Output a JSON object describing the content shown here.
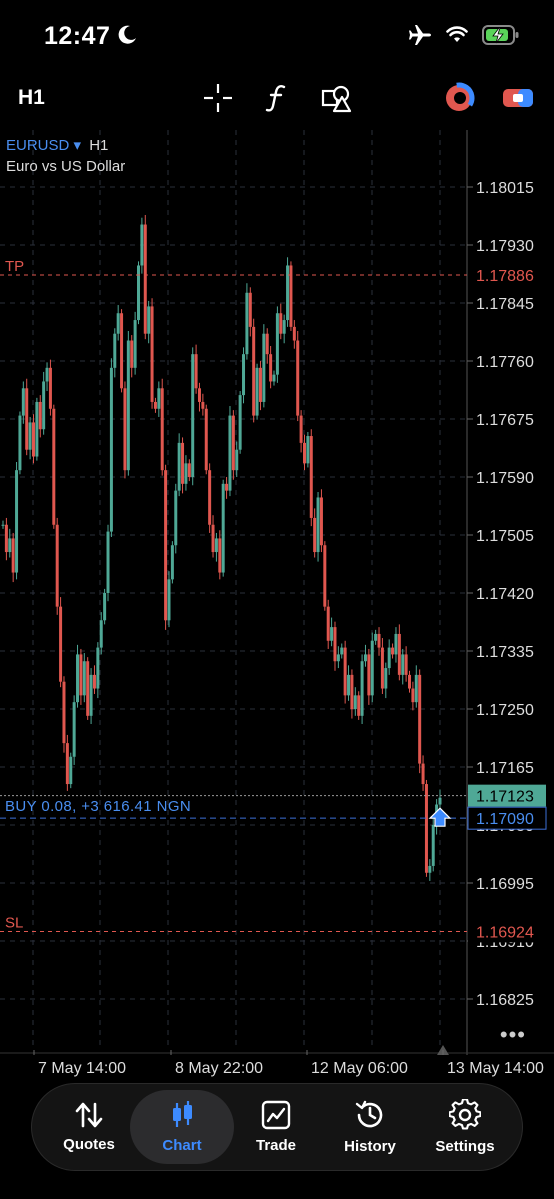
{
  "status": {
    "time": "12:47"
  },
  "toolbar": {
    "timeframe": "H1"
  },
  "chart": {
    "symbol": "EURUSD",
    "symbol_arrow": "▾",
    "timeframe": "H1",
    "description": "Euro vs US Dollar",
    "y_ticks": [
      "1.18015",
      "1.17930",
      "1.17845",
      "1.17760",
      "1.17675",
      "1.17590",
      "1.17505",
      "1.17420",
      "1.17335",
      "1.17250",
      "1.17165",
      "1.17080",
      "1.16995",
      "1.16910",
      "1.16825"
    ],
    "x_ticks": [
      "7 May 14:00",
      "8 May 22:00",
      "12 May 06:00",
      "13 May 14:00"
    ],
    "tp": {
      "label": "TP",
      "price": "1.17886"
    },
    "sl": {
      "label": "SL",
      "price": "1.16924"
    },
    "position": {
      "label": "BUY 0.08, +3 616.41 NGN",
      "price": "1.17090"
    },
    "bid": {
      "price": "1.17123"
    },
    "more": "•••",
    "colors": {
      "bull": "#4fa896",
      "bear": "#e0574f",
      "accent": "#3d8bff",
      "tp_sl": "#e0574f"
    }
  },
  "chart_data": {
    "type": "candlestick",
    "symbol": "EURUSD",
    "ylim": [
      1.1678,
      1.1808
    ],
    "x_ticks": [
      "7 May 14:00",
      "8 May 22:00",
      "12 May 06:00",
      "13 May 14:00"
    ],
    "closes": [
      1.1752,
      1.1748,
      1.175,
      1.1745,
      1.176,
      1.1768,
      1.1772,
      1.1763,
      1.1767,
      1.1762,
      1.177,
      1.1766,
      1.1773,
      1.1775,
      1.1769,
      1.1752,
      1.174,
      1.1729,
      1.172,
      1.1714,
      1.1718,
      1.1726,
      1.1733,
      1.1727,
      1.1732,
      1.1724,
      1.173,
      1.1728,
      1.1734,
      1.1738,
      1.1742,
      1.1751,
      1.1775,
      1.178,
      1.1783,
      1.1772,
      1.176,
      1.1779,
      1.1775,
      1.1782,
      1.179,
      1.1796,
      1.178,
      1.1784,
      1.177,
      1.1769,
      1.1772,
      1.176,
      1.1738,
      1.1744,
      1.1749,
      1.1757,
      1.1764,
      1.1758,
      1.1761,
      1.1759,
      1.1777,
      1.1772,
      1.177,
      1.1769,
      1.176,
      1.1752,
      1.1748,
      1.175,
      1.1745,
      1.1758,
      1.1757,
      1.1768,
      1.176,
      1.1763,
      1.1771,
      1.1777,
      1.1786,
      1.1781,
      1.1768,
      1.1775,
      1.177,
      1.178,
      1.1777,
      1.1773,
      1.1774,
      1.1783,
      1.178,
      1.1782,
      1.179,
      1.1781,
      1.1779,
      1.1768,
      1.1764,
      1.1761,
      1.1765,
      1.1753,
      1.1748,
      1.1756,
      1.1749,
      1.174,
      1.1735,
      1.1737,
      1.1732,
      1.1733,
      1.1734,
      1.1727,
      1.173,
      1.1725,
      1.1727,
      1.1724,
      1.1732,
      1.1733,
      1.1727,
      1.1735,
      1.1736,
      1.1734,
      1.1728,
      1.1731,
      1.1734,
      1.1733,
      1.1736,
      1.173,
      1.1733,
      1.173,
      1.1728,
      1.1726,
      1.173,
      1.1717,
      1.1714,
      1.1701,
      1.1702,
      1.1708,
      1.1711,
      1.1712
    ]
  }
}
